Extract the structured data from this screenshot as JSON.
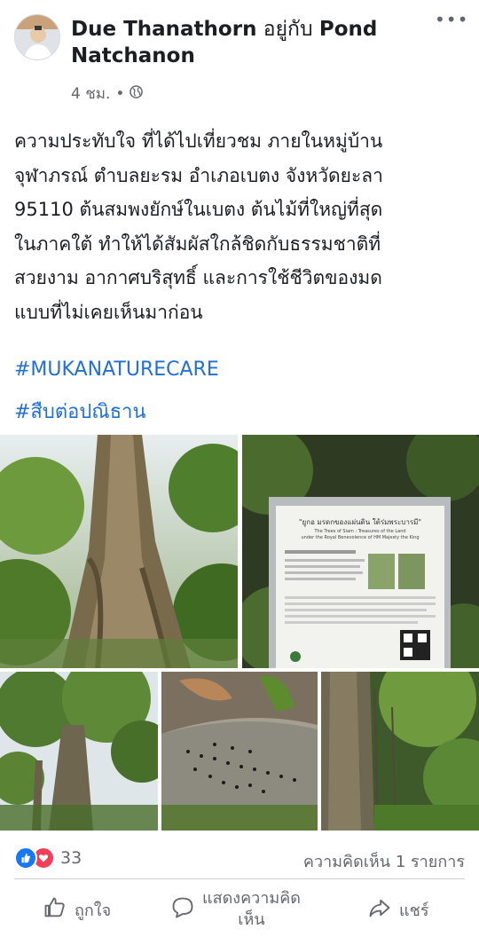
{
  "post": {
    "author": "Due Thanathorn",
    "with_text": "อยู่กับ",
    "tagged": "Pond Natchanon",
    "time": "4 ชม.",
    "separator": "•",
    "privacy_icon": "globe-icon",
    "text_lines": [
      "ความประทับใจ ที่ได้ไปเที่ยวชม ภายในหมู่บ้าน",
      "จุฬาภรณ์ ตำบลยะรม อำเภอเบตง จังหวัดยะลา",
      "95110 ต้นสมพงยักษ์ในเบตง ต้นไม้ที่ใหญ่ที่สุด",
      "ในภาคใต้ ทำให้ได้สัมผัสใกล้ชิดกับธรรมชาติที่",
      "สวยงาม อากาศบริสุทธิ์  และการใช้ชีวิตของมด",
      "แบบที่ไม่เคยเห็นมาก่อน"
    ],
    "hashtags": [
      "#MUKANATURECARE",
      "#สืบต่อปณิธาน"
    ],
    "hashtag_color": "#216fdb"
  },
  "photos": {
    "sign": {
      "title": "\"ยูกอ มรดกของแผ่นดิน ใต้ร่มพระบารมี\"",
      "subtitle_1": "The Trees of Siam : Treasures of the Land",
      "subtitle_2": "under the Royal Benevolence of HM Majesty the King"
    }
  },
  "stats": {
    "reaction_count": "33",
    "comments": "ความคิดเห็น 1 รายการ"
  },
  "actions": {
    "like": "ถูกใจ",
    "comment_line1": "แสดงความคิด",
    "comment_line2": "เห็น",
    "share": "แชร์"
  },
  "colors": {
    "like_blue": "#1877f2",
    "love_red": "#f33e58",
    "secondary_text": "#65676b"
  }
}
